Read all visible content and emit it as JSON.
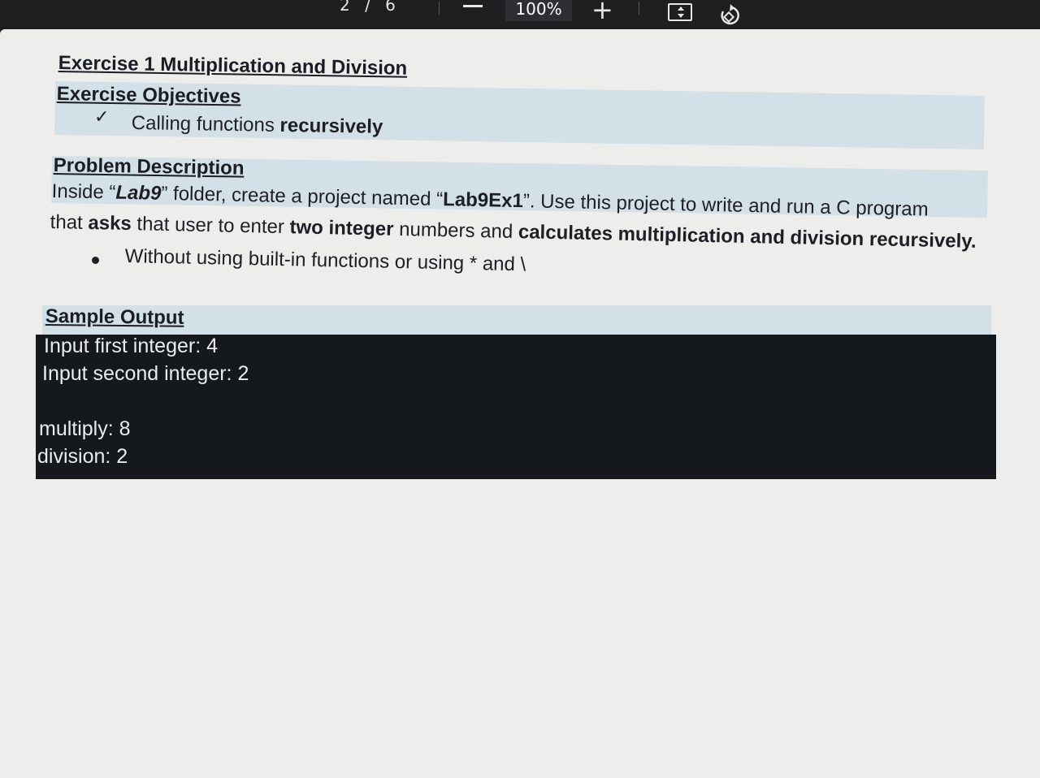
{
  "toolbar": {
    "page_indicator": "2 / 6",
    "zoom_level": "100%",
    "zoom_in_label": "+",
    "zoom_out_icon": "minus-icon",
    "fit_icon": "fit-page-icon",
    "rotate_icon": "rotate-icon"
  },
  "document": {
    "exercise_title": "Exercise 1 Multiplication and Division",
    "objectives_heading": "Exercise Objectives",
    "objective_item": {
      "icon": "check-icon",
      "text_plain": "Calling functions ",
      "text_bold": "recursively"
    },
    "problem_heading": "Problem Description",
    "problem_line1": {
      "t1": "Inside “",
      "b1": "Lab9",
      "t2": "” folder, create a project named “",
      "b2": "Lab9Ex1",
      "t3": "”. Use this project to write and run a C program"
    },
    "problem_line2": {
      "t1": "that ",
      "b1": "asks",
      "t2": " that user to enter ",
      "b2": "two integer",
      "t3": " numbers and ",
      "b3": "calculates multiplication and division recursively."
    },
    "bullet_item": "Without using built-in functions or using * and \\",
    "sample_heading": "Sample Output",
    "console_lines": [
      "Input first integer: 4",
      "Input second integer: 2",
      "",
      "multiply: 8",
      "division: 2"
    ]
  },
  "colors": {
    "toolbar_bg": "#1e1f21",
    "heading_band": "#cfdde6",
    "console_bg": "#15181d",
    "console_text": "#e9ecef"
  }
}
